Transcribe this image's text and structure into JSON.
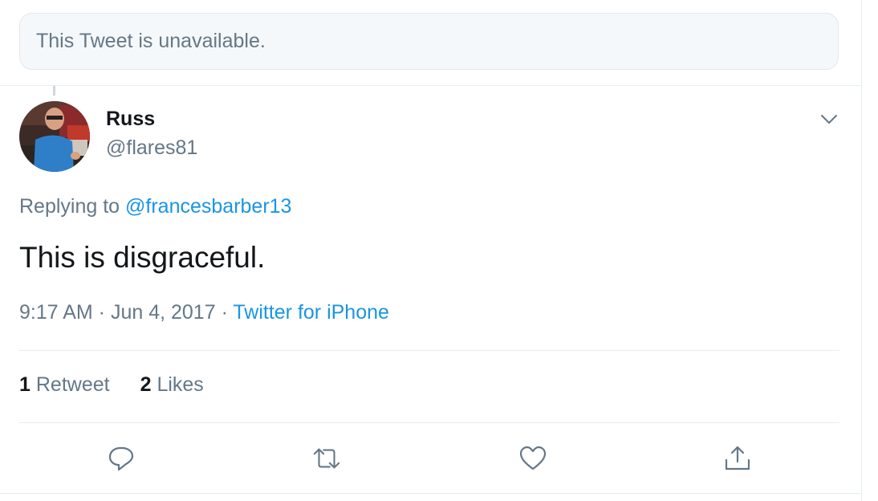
{
  "unavailable": {
    "text": "This Tweet is unavailable."
  },
  "tweet": {
    "author": {
      "display_name": "Russ",
      "handle": "@flares81"
    },
    "reply": {
      "prefix": "Replying to ",
      "target": "@francesbarber13"
    },
    "text": "This is disgraceful.",
    "meta": {
      "time": "9:17 AM",
      "separator": " · ",
      "date": "Jun 4, 2017",
      "source": "Twitter for iPhone"
    },
    "stats": {
      "retweets_count": "1",
      "retweets_label": "Retweet",
      "likes_count": "2",
      "likes_label": "Likes"
    }
  },
  "icons": {
    "caret": "chevron-down-icon",
    "reply": "reply-icon",
    "retweet": "retweet-icon",
    "like": "heart-icon",
    "share": "share-icon"
  },
  "colors": {
    "link": "#1b95e0",
    "muted": "#657786",
    "text": "#14171a",
    "border": "#e6ecf0"
  }
}
